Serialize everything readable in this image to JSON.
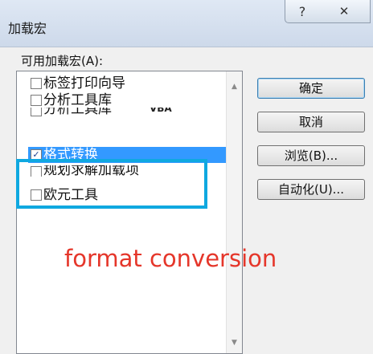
{
  "window": {
    "title": "加载宏",
    "help_glyph": "?",
    "close_glyph": "✕"
  },
  "list": {
    "label": "可用加载宏(A):",
    "items": [
      {
        "label": "标签打印向导",
        "checked": false
      },
      {
        "label": "分析工具库",
        "checked": false
      },
      {
        "label": "分析工具库",
        "suffix": "VBA",
        "checked": false
      },
      {
        "label": "格式转换",
        "checked": true,
        "selected": true
      },
      {
        "label": "规划求解加载项",
        "checked": false
      },
      {
        "label": "欧元工具",
        "checked": false
      }
    ],
    "scroll_up": "▲",
    "scroll_down": "▼"
  },
  "buttons": {
    "ok": "确定",
    "cancel": "取消",
    "browse": "浏览(B)...",
    "automation": "自动化(U)..."
  },
  "annotation": {
    "text": "format conversion",
    "color": "#e5362a",
    "box_color": "#0fa8e0"
  },
  "colors": {
    "selection": "#3399ff"
  }
}
